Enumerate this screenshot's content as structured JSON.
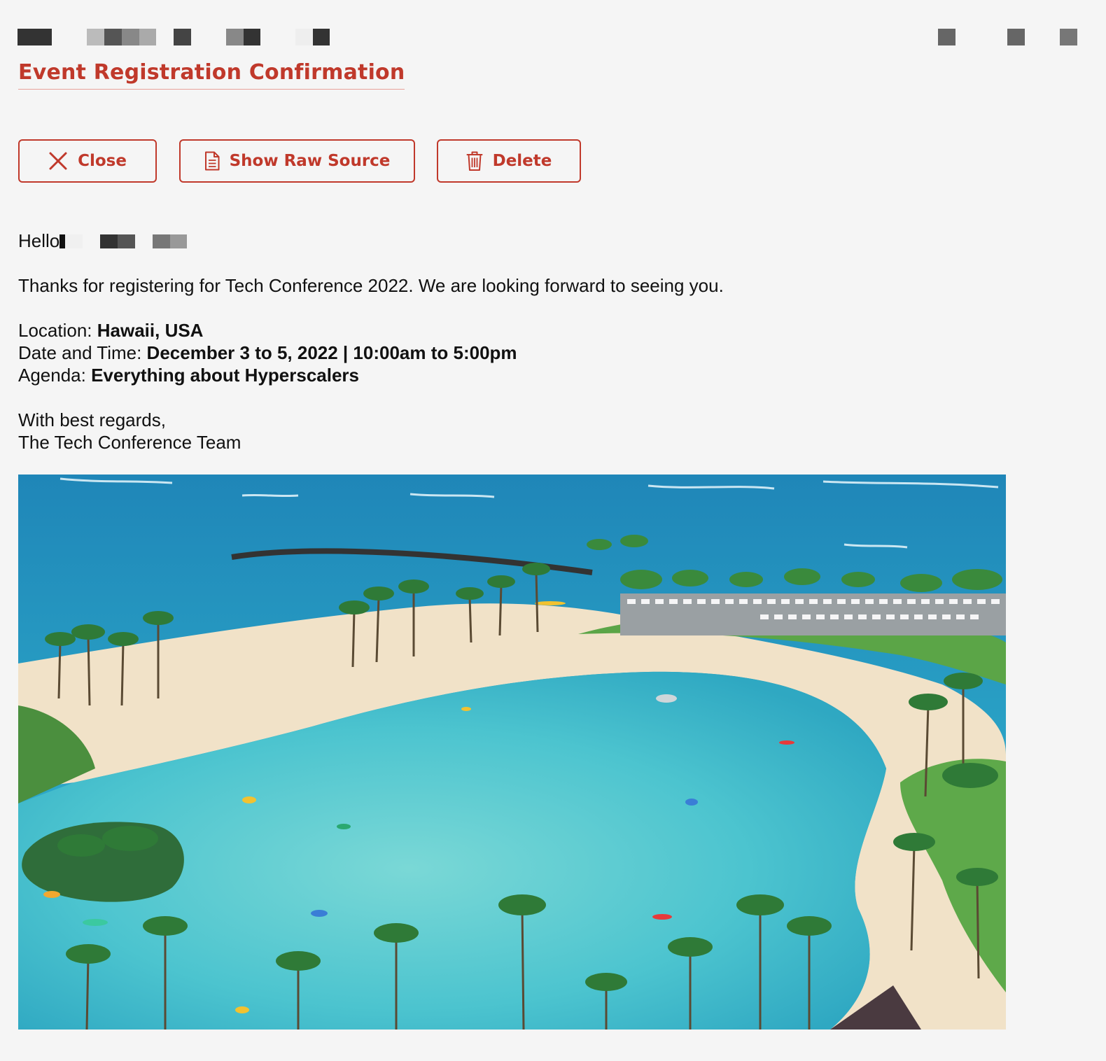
{
  "email": {
    "subject": "Event Registration Confirmation",
    "greeting": "Hello",
    "intro": "Thanks for registering for Tech Conference 2022. We are looking forward to seeing you.",
    "details": {
      "location_label": "Location: ",
      "location_value": "Hawaii, USA",
      "datetime_label": "Date and Time: ",
      "datetime_value": "December 3 to 5, 2022 | 10:00am to 5:00pm",
      "agenda_label": "Agenda: ",
      "agenda_value": "Everything about Hyperscalers"
    },
    "signoff": "With best regards,",
    "signature": "The Tech Conference Team"
  },
  "toolbar": {
    "close_label": "Close",
    "raw_source_label": "Show Raw Source",
    "delete_label": "Delete"
  },
  "icons": {
    "close": "close-icon",
    "raw_source": "document-icon",
    "delete": "trash-icon"
  },
  "colors": {
    "accent": "#c0392b",
    "background": "#f5f5f5",
    "text": "#111111"
  }
}
